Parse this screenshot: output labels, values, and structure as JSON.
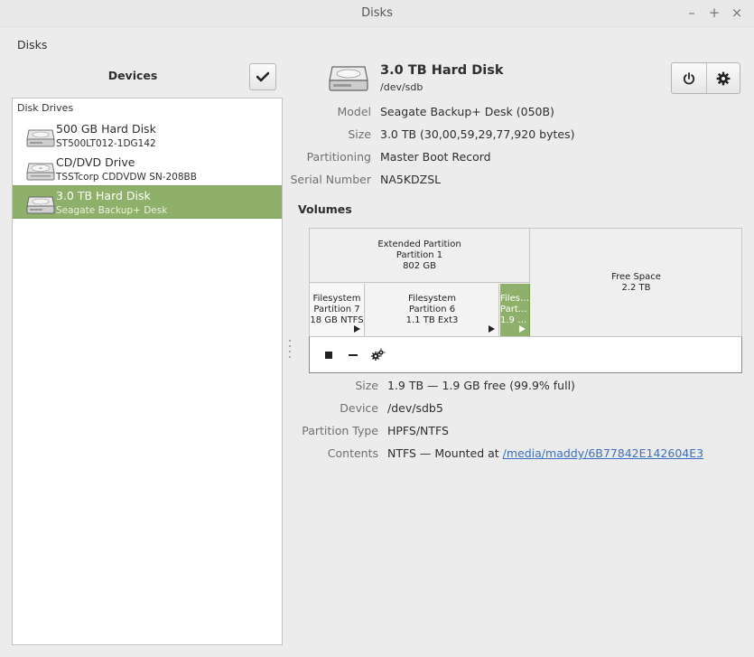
{
  "window": {
    "title": "Disks",
    "minimize": "–",
    "maximize": "+",
    "close": "×"
  },
  "menu": {
    "app_label": "Disks"
  },
  "sidebar": {
    "title": "Devices",
    "section_header": "Disk Drives",
    "items": [
      {
        "name": "500 GB Hard Disk",
        "sub": "ST500LT012-1DG142",
        "icon": "hard-disk-icon",
        "selected": false
      },
      {
        "name": "CD/DVD Drive",
        "sub": "TSSTcorp CDDVDW SN-208BB",
        "icon": "optical-drive-icon",
        "selected": false
      },
      {
        "name": "3.0 TB Hard Disk",
        "sub": "Seagate Backup+ Desk",
        "icon": "hard-disk-icon",
        "selected": true
      }
    ]
  },
  "disk": {
    "title": "3.0 TB Hard Disk",
    "path": "/dev/sdb",
    "properties": [
      {
        "label": "Model",
        "value": "Seagate Backup+ Desk (050B)"
      },
      {
        "label": "Size",
        "value": "3.0 TB (30,00,59,29,77,920 bytes)"
      },
      {
        "label": "Partitioning",
        "value": "Master Boot Record"
      },
      {
        "label": "Serial Number",
        "value": "NA5KDZSL"
      }
    ]
  },
  "volumes": {
    "title": "Volumes",
    "segments": {
      "extended": [
        "Extended Partition",
        "Partition 1",
        "802 GB"
      ],
      "free": [
        "Free Space",
        "2.2 TB"
      ],
      "p7": [
        "Filesystem",
        "Partition 7",
        "18 GB NTFS"
      ],
      "p6": [
        "Filesystem",
        "Partition 6",
        "1.1 TB Ext3"
      ],
      "p5": [
        "Filesy…",
        "Partit…",
        "1.9 T…"
      ]
    },
    "selected": {
      "properties": [
        {
          "label": "Size",
          "value": "1.9 TB — 1.9 GB free (99.9% full)"
        },
        {
          "label": "Device",
          "value": "/dev/sdb5"
        },
        {
          "label": "Partition Type",
          "value": "HPFS/NTFS"
        },
        {
          "label": "Contents",
          "value": "NTFS — Mounted at ",
          "link": "/media/maddy/6B77842E142604E3"
        }
      ]
    }
  },
  "colors": {
    "selection": "#8fb06b",
    "link": "#3a6fc4"
  }
}
